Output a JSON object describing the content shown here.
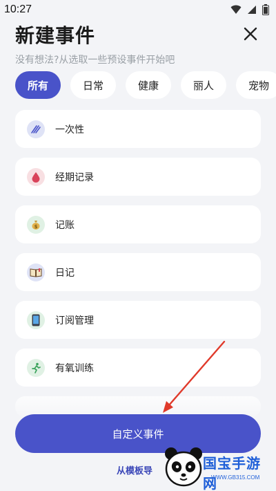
{
  "status_bar": {
    "time": "10:27"
  },
  "header": {
    "title": "新建事件",
    "subtitle": "没有想法?从选取一些预设事件开始吧",
    "close_icon": "close-icon"
  },
  "tabs": [
    {
      "label": "所有",
      "active": true
    },
    {
      "label": "日常",
      "active": false
    },
    {
      "label": "健康",
      "active": false
    },
    {
      "label": "丽人",
      "active": false
    },
    {
      "label": "宠物",
      "active": false
    }
  ],
  "events": [
    {
      "label": "一次性",
      "icon": "pen-icon",
      "icon_bg": "#dfe3f6"
    },
    {
      "label": "经期记录",
      "icon": "blood-drop-icon",
      "icon_bg": "#f8dfe2"
    },
    {
      "label": "记账",
      "icon": "money-bag-icon",
      "icon_bg": "#e0f1e4"
    },
    {
      "label": "日记",
      "icon": "book-icon",
      "icon_bg": "#dfe3f6"
    },
    {
      "label": "订阅管理",
      "icon": "phone-icon",
      "icon_bg": "#e0f1e4"
    },
    {
      "label": "有氧训练",
      "icon": "runner-icon",
      "icon_bg": "#e0f1e4"
    }
  ],
  "primary_button": {
    "label": "自定义事件"
  },
  "import_link": {
    "label": "从模板导"
  },
  "watermark": {
    "text": "国宝手游网",
    "url": "WWW.GB315.COM"
  },
  "colors": {
    "accent": "#4953c9",
    "background": "#f3f4f7",
    "card": "#ffffff",
    "annotation_arrow": "#e03a2b"
  }
}
